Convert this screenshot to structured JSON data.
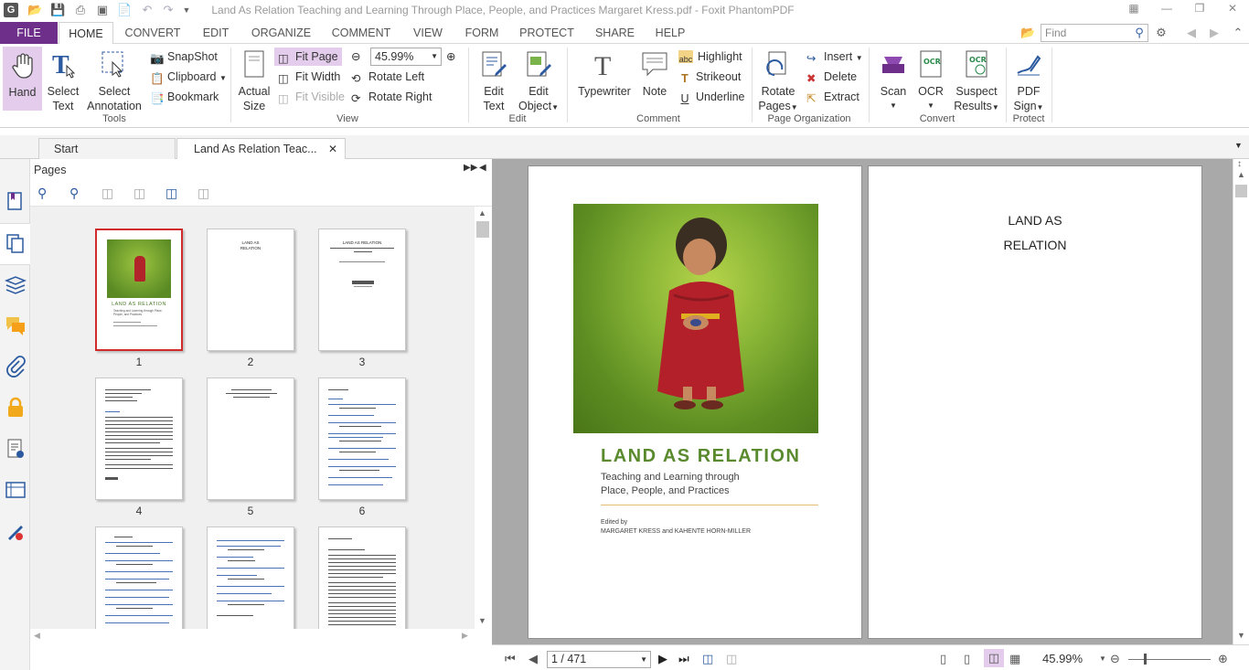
{
  "window": {
    "title": "Land As Relation Teaching and Learning Through Place, People, and Practices Margaret Kress.pdf - Foxit PhantomPDF"
  },
  "ribbon_tabs": [
    "FILE",
    "HOME",
    "CONVERT",
    "EDIT",
    "ORGANIZE",
    "COMMENT",
    "VIEW",
    "FORM",
    "PROTECT",
    "SHARE",
    "HELP"
  ],
  "search": {
    "placeholder": "Find"
  },
  "tools": {
    "hand": "Hand",
    "select_text_1": "Select",
    "select_text_2": "Text",
    "select_annot_1": "Select",
    "select_annot_2": "Annotation",
    "snapshot": "SnapShot",
    "clipboard": "Clipboard",
    "bookmark": "Bookmark",
    "group": "Tools"
  },
  "view": {
    "actual_1": "Actual",
    "actual_2": "Size",
    "fit_page": "Fit Page",
    "fit_width": "Fit Width",
    "fit_visible": "Fit Visible",
    "zoom": "45.99%",
    "rotate_left": "Rotate Left",
    "rotate_right": "Rotate Right",
    "group": "View"
  },
  "edit": {
    "edit_text_1": "Edit",
    "edit_text_2": "Text",
    "edit_obj_1": "Edit",
    "edit_obj_2": "Object",
    "group": "Edit"
  },
  "comment": {
    "typewriter": "Typewriter",
    "note": "Note",
    "highlight": "Highlight",
    "strikeout": "Strikeout",
    "underline": "Underline",
    "group": "Comment"
  },
  "organize": {
    "rotate_1": "Rotate",
    "rotate_2": "Pages",
    "insert": "Insert",
    "delete": "Delete",
    "extract": "Extract",
    "group": "Page Organization"
  },
  "convert": {
    "scan": "Scan",
    "ocr": "OCR",
    "suspect_1": "Suspect",
    "suspect_2": "Results",
    "group": "Convert"
  },
  "protect": {
    "pdf_1": "PDF",
    "sign": "Sign",
    "group": "Protect"
  },
  "doc_tabs": {
    "start": "Start",
    "current": "Land As Relation Teac..."
  },
  "pages_panel": {
    "title": "Pages",
    "thumb_numbers": [
      "1",
      "2",
      "3",
      "4",
      "5",
      "6"
    ]
  },
  "thumb_text": {
    "cover_title": "LAND AS RELATION",
    "cover_sub": "Teaching and Learning through Place, People, and Practices",
    "p2_title_1": "LAND AS",
    "p2_title_2": "RELATION",
    "p3_title": "LAND AS RELATION"
  },
  "cover": {
    "title": "LAND AS RELATION",
    "subtitle_1": "Teaching and Learning through",
    "subtitle_2": "Place, People, and Practices",
    "edited_by": "Edited by",
    "editors": "MARGARET KRESS and KAHENTE HORN-MILLER"
  },
  "page2": {
    "line1": "LAND AS",
    "line2": "RELATION"
  },
  "status": {
    "page_field": "1 / 471",
    "zoom": "45.99%"
  },
  "colors": {
    "file_tab": "#6d2f8a",
    "cover_title_green": "#5a8a2e",
    "accent_highlight": "#e4cdec",
    "selected_thumb": "#d12a2a"
  }
}
